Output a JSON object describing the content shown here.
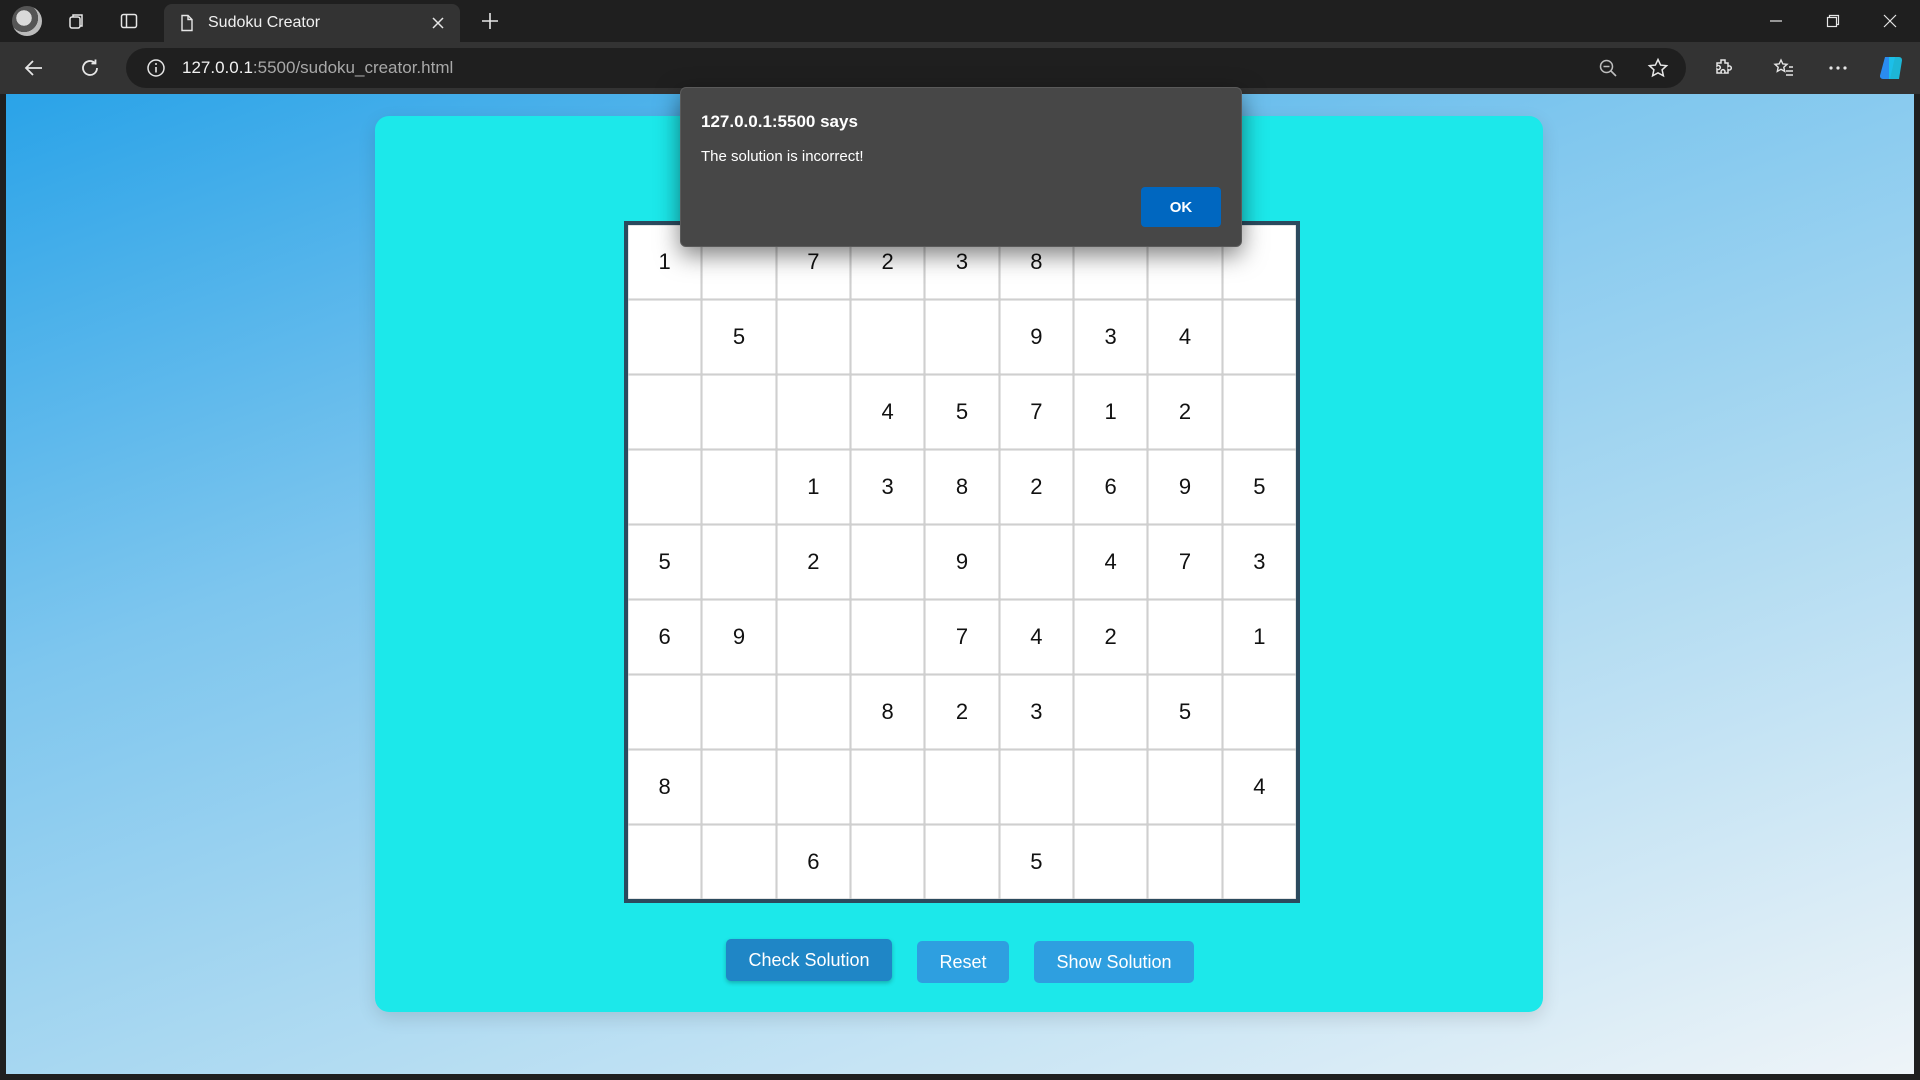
{
  "browser": {
    "tab_title": "Sudoku Creator",
    "url_host": "127.0.0.1",
    "url_rest": ":5500/sudoku_creator.html"
  },
  "page": {
    "title": "Sudoku Creator",
    "grid": [
      [
        "1",
        "",
        "7",
        "2",
        "3",
        "8",
        "",
        "",
        ""
      ],
      [
        "",
        "5",
        "",
        "",
        "",
        "9",
        "3",
        "4",
        ""
      ],
      [
        "",
        "",
        "",
        "4",
        "5",
        "7",
        "1",
        "2",
        ""
      ],
      [
        "",
        "",
        "1",
        "3",
        "8",
        "2",
        "6",
        "9",
        "5"
      ],
      [
        "5",
        "",
        "2",
        "",
        "9",
        "",
        "4",
        "7",
        "3"
      ],
      [
        "6",
        "9",
        "",
        "",
        "7",
        "4",
        "2",
        "",
        "1"
      ],
      [
        "",
        "",
        "",
        "8",
        "2",
        "3",
        "",
        "5",
        ""
      ],
      [
        "8",
        "",
        "",
        "",
        "",
        "",
        "",
        "",
        "4"
      ],
      [
        "",
        "",
        "6",
        "",
        "",
        "5",
        "",
        "",
        ""
      ]
    ],
    "buttons": {
      "check": "Check Solution",
      "reset": "Reset",
      "show": "Show Solution"
    }
  },
  "dialog": {
    "origin": "127.0.0.1:5500 says",
    "message": "The solution is incorrect!",
    "ok_label": "OK"
  },
  "colors": {
    "card": "#1ce8ea",
    "button": "#2e9fe0",
    "button_active": "#1f86c6",
    "dialog_ok": "#0067c0"
  }
}
